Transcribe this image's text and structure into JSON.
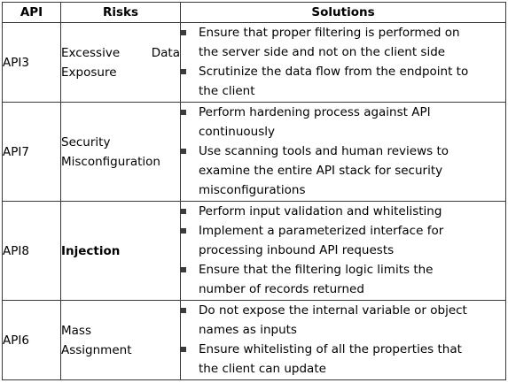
{
  "headers": {
    "api": "API",
    "risks": "Risks",
    "solutions": "Solutions"
  },
  "rows": [
    {
      "api": "API3",
      "risk_lines": [
        "Excessive Data",
        "Exposure"
      ],
      "risk_bold": false,
      "solutions": [
        [
          "Ensure that proper filtering is performed on",
          "the server side and not on the client side"
        ],
        [
          "Scrutinize the data flow from the endpoint to",
          "the client"
        ]
      ]
    },
    {
      "api": "API7",
      "risk_lines": [
        "Security",
        "Misconfiguration"
      ],
      "risk_bold": false,
      "solutions": [
        [
          "Perform hardening process against API",
          "continuously"
        ],
        [
          "Use scanning tools and human reviews to",
          "examine the entire API stack for security",
          "misconfigurations"
        ]
      ]
    },
    {
      "api": "API8",
      "risk_lines": [
        "Injection"
      ],
      "risk_bold": true,
      "solutions": [
        [
          "Perform input validation and whitelisting"
        ],
        [
          "Implement a parameterized interface for",
          "processing inbound API requests"
        ],
        [
          "Ensure that the filtering logic limits the",
          "number of records returned"
        ]
      ]
    },
    {
      "api": "API6",
      "risk_lines": [
        "Mass",
        "Assignment"
      ],
      "risk_bold": false,
      "solutions": [
        [
          "Do not expose the internal variable or object",
          "names as inputs"
        ],
        [
          "Ensure whitelisting of all the properties that",
          "the client can update"
        ]
      ]
    }
  ]
}
